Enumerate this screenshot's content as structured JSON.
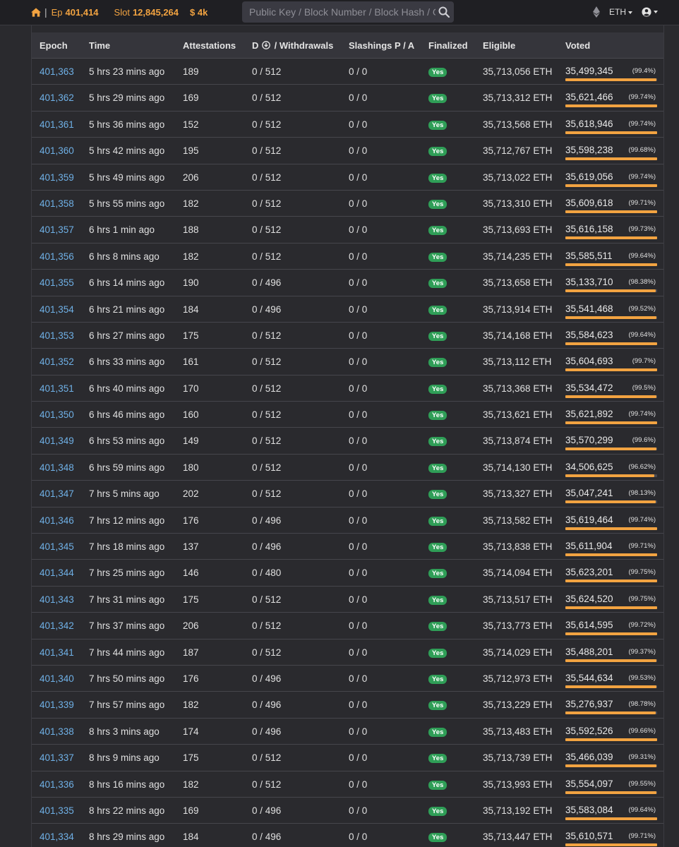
{
  "nav": {
    "epoch_label": "Ep",
    "epoch_value": "401,414",
    "slot_label": "Slot",
    "slot_value": "12,845,264",
    "price": "$ 4k",
    "search_placeholder": "Public Key / Block Number / Block Hash / Graffiti",
    "currency": "ETH",
    "icons": [
      "home-icon",
      "search-icon",
      "ethereum-logo-icon",
      "user-circle-icon",
      "chevron-down-icon"
    ]
  },
  "colors": {
    "accent": "#f2a341",
    "link": "#6fb0e6",
    "badge": "#2f9e57",
    "background": "#2a2a2e",
    "navbar": "#1f1f23"
  },
  "table": {
    "headers": {
      "epoch": "Epoch",
      "time": "Time",
      "attestations": "Attestations",
      "deposits_prefix": "D",
      "deposits_suffix": "/ Withdrawals",
      "slashings": "Slashings P / A",
      "finalized": "Finalized",
      "eligible": "Eligible",
      "voted": "Voted"
    },
    "rows": [
      {
        "epoch": "401,363",
        "time": "5 hrs 23 mins ago",
        "attestations": "189",
        "dw": "0 / 512",
        "slashings": "0 / 0",
        "finalized": "Yes",
        "eligible": "35,713,056 ETH",
        "voted": "35,499,345",
        "voted_pct": "(99.4%)",
        "fill": 99.4
      },
      {
        "epoch": "401,362",
        "time": "5 hrs 29 mins ago",
        "attestations": "169",
        "dw": "0 / 512",
        "slashings": "0 / 0",
        "finalized": "Yes",
        "eligible": "35,713,312 ETH",
        "voted": "35,621,466",
        "voted_pct": "(99.74%)",
        "fill": 99.74
      },
      {
        "epoch": "401,361",
        "time": "5 hrs 36 mins ago",
        "attestations": "152",
        "dw": "0 / 512",
        "slashings": "0 / 0",
        "finalized": "Yes",
        "eligible": "35,713,568 ETH",
        "voted": "35,618,946",
        "voted_pct": "(99.74%)",
        "fill": 99.74
      },
      {
        "epoch": "401,360",
        "time": "5 hrs 42 mins ago",
        "attestations": "195",
        "dw": "0 / 512",
        "slashings": "0 / 0",
        "finalized": "Yes",
        "eligible": "35,712,767 ETH",
        "voted": "35,598,238",
        "voted_pct": "(99.68%)",
        "fill": 99.68
      },
      {
        "epoch": "401,359",
        "time": "5 hrs 49 mins ago",
        "attestations": "206",
        "dw": "0 / 512",
        "slashings": "0 / 0",
        "finalized": "Yes",
        "eligible": "35,713,022 ETH",
        "voted": "35,619,056",
        "voted_pct": "(99.74%)",
        "fill": 99.74
      },
      {
        "epoch": "401,358",
        "time": "5 hrs 55 mins ago",
        "attestations": "182",
        "dw": "0 / 512",
        "slashings": "0 / 0",
        "finalized": "Yes",
        "eligible": "35,713,310 ETH",
        "voted": "35,609,618",
        "voted_pct": "(99.71%)",
        "fill": 99.71
      },
      {
        "epoch": "401,357",
        "time": "6 hrs 1 min ago",
        "attestations": "188",
        "dw": "0 / 512",
        "slashings": "0 / 0",
        "finalized": "Yes",
        "eligible": "35,713,693 ETH",
        "voted": "35,616,158",
        "voted_pct": "(99.73%)",
        "fill": 99.73
      },
      {
        "epoch": "401,356",
        "time": "6 hrs 8 mins ago",
        "attestations": "182",
        "dw": "0 / 512",
        "slashings": "0 / 0",
        "finalized": "Yes",
        "eligible": "35,714,235 ETH",
        "voted": "35,585,511",
        "voted_pct": "(99.64%)",
        "fill": 99.64
      },
      {
        "epoch": "401,355",
        "time": "6 hrs 14 mins ago",
        "attestations": "190",
        "dw": "0 / 496",
        "slashings": "0 / 0",
        "finalized": "Yes",
        "eligible": "35,713,658 ETH",
        "voted": "35,133,710",
        "voted_pct": "(98.38%)",
        "fill": 98.38
      },
      {
        "epoch": "401,354",
        "time": "6 hrs 21 mins ago",
        "attestations": "184",
        "dw": "0 / 496",
        "slashings": "0 / 0",
        "finalized": "Yes",
        "eligible": "35,713,914 ETH",
        "voted": "35,541,468",
        "voted_pct": "(99.52%)",
        "fill": 99.52
      },
      {
        "epoch": "401,353",
        "time": "6 hrs 27 mins ago",
        "attestations": "175",
        "dw": "0 / 512",
        "slashings": "0 / 0",
        "finalized": "Yes",
        "eligible": "35,714,168 ETH",
        "voted": "35,584,623",
        "voted_pct": "(99.64%)",
        "fill": 99.64
      },
      {
        "epoch": "401,352",
        "time": "6 hrs 33 mins ago",
        "attestations": "161",
        "dw": "0 / 512",
        "slashings": "0 / 0",
        "finalized": "Yes",
        "eligible": "35,713,112 ETH",
        "voted": "35,604,693",
        "voted_pct": "(99.7%)",
        "fill": 99.7
      },
      {
        "epoch": "401,351",
        "time": "6 hrs 40 mins ago",
        "attestations": "170",
        "dw": "0 / 512",
        "slashings": "0 / 0",
        "finalized": "Yes",
        "eligible": "35,713,368 ETH",
        "voted": "35,534,472",
        "voted_pct": "(99.5%)",
        "fill": 99.5
      },
      {
        "epoch": "401,350",
        "time": "6 hrs 46 mins ago",
        "attestations": "160",
        "dw": "0 / 512",
        "slashings": "0 / 0",
        "finalized": "Yes",
        "eligible": "35,713,621 ETH",
        "voted": "35,621,892",
        "voted_pct": "(99.74%)",
        "fill": 99.74
      },
      {
        "epoch": "401,349",
        "time": "6 hrs 53 mins ago",
        "attestations": "149",
        "dw": "0 / 512",
        "slashings": "0 / 0",
        "finalized": "Yes",
        "eligible": "35,713,874 ETH",
        "voted": "35,570,299",
        "voted_pct": "(99.6%)",
        "fill": 99.6
      },
      {
        "epoch": "401,348",
        "time": "6 hrs 59 mins ago",
        "attestations": "180",
        "dw": "0 / 512",
        "slashings": "0 / 0",
        "finalized": "Yes",
        "eligible": "35,714,130 ETH",
        "voted": "34,506,625",
        "voted_pct": "(96.62%)",
        "fill": 96.62
      },
      {
        "epoch": "401,347",
        "time": "7 hrs 5 mins ago",
        "attestations": "202",
        "dw": "0 / 512",
        "slashings": "0 / 0",
        "finalized": "Yes",
        "eligible": "35,713,327 ETH",
        "voted": "35,047,241",
        "voted_pct": "(98.13%)",
        "fill": 98.13
      },
      {
        "epoch": "401,346",
        "time": "7 hrs 12 mins ago",
        "attestations": "176",
        "dw": "0 / 496",
        "slashings": "0 / 0",
        "finalized": "Yes",
        "eligible": "35,713,582 ETH",
        "voted": "35,619,464",
        "voted_pct": "(99.74%)",
        "fill": 99.74
      },
      {
        "epoch": "401,345",
        "time": "7 hrs 18 mins ago",
        "attestations": "137",
        "dw": "0 / 496",
        "slashings": "0 / 0",
        "finalized": "Yes",
        "eligible": "35,713,838 ETH",
        "voted": "35,611,904",
        "voted_pct": "(99.71%)",
        "fill": 99.71
      },
      {
        "epoch": "401,344",
        "time": "7 hrs 25 mins ago",
        "attestations": "146",
        "dw": "0 / 480",
        "slashings": "0 / 0",
        "finalized": "Yes",
        "eligible": "35,714,094 ETH",
        "voted": "35,623,201",
        "voted_pct": "(99.75%)",
        "fill": 99.75
      },
      {
        "epoch": "401,343",
        "time": "7 hrs 31 mins ago",
        "attestations": "175",
        "dw": "0 / 512",
        "slashings": "0 / 0",
        "finalized": "Yes",
        "eligible": "35,713,517 ETH",
        "voted": "35,624,520",
        "voted_pct": "(99.75%)",
        "fill": 99.75
      },
      {
        "epoch": "401,342",
        "time": "7 hrs 37 mins ago",
        "attestations": "206",
        "dw": "0 / 512",
        "slashings": "0 / 0",
        "finalized": "Yes",
        "eligible": "35,713,773 ETH",
        "voted": "35,614,595",
        "voted_pct": "(99.72%)",
        "fill": 99.72
      },
      {
        "epoch": "401,341",
        "time": "7 hrs 44 mins ago",
        "attestations": "187",
        "dw": "0 / 512",
        "slashings": "0 / 0",
        "finalized": "Yes",
        "eligible": "35,714,029 ETH",
        "voted": "35,488,201",
        "voted_pct": "(99.37%)",
        "fill": 99.37
      },
      {
        "epoch": "401,340",
        "time": "7 hrs 50 mins ago",
        "attestations": "176",
        "dw": "0 / 496",
        "slashings": "0 / 0",
        "finalized": "Yes",
        "eligible": "35,712,973 ETH",
        "voted": "35,544,634",
        "voted_pct": "(99.53%)",
        "fill": 99.53
      },
      {
        "epoch": "401,339",
        "time": "7 hrs 57 mins ago",
        "attestations": "182",
        "dw": "0 / 496",
        "slashings": "0 / 0",
        "finalized": "Yes",
        "eligible": "35,713,229 ETH",
        "voted": "35,276,937",
        "voted_pct": "(98.78%)",
        "fill": 98.78
      },
      {
        "epoch": "401,338",
        "time": "8 hrs 3 mins ago",
        "attestations": "174",
        "dw": "0 / 496",
        "slashings": "0 / 0",
        "finalized": "Yes",
        "eligible": "35,713,483 ETH",
        "voted": "35,592,526",
        "voted_pct": "(99.66%)",
        "fill": 99.66
      },
      {
        "epoch": "401,337",
        "time": "8 hrs 9 mins ago",
        "attestations": "175",
        "dw": "0 / 512",
        "slashings": "0 / 0",
        "finalized": "Yes",
        "eligible": "35,713,739 ETH",
        "voted": "35,466,039",
        "voted_pct": "(99.31%)",
        "fill": 99.31
      },
      {
        "epoch": "401,336",
        "time": "8 hrs 16 mins ago",
        "attestations": "182",
        "dw": "0 / 512",
        "slashings": "0 / 0",
        "finalized": "Yes",
        "eligible": "35,713,993 ETH",
        "voted": "35,554,097",
        "voted_pct": "(99.55%)",
        "fill": 99.55
      },
      {
        "epoch": "401,335",
        "time": "8 hrs 22 mins ago",
        "attestations": "169",
        "dw": "0 / 496",
        "slashings": "0 / 0",
        "finalized": "Yes",
        "eligible": "35,713,192 ETH",
        "voted": "35,583,084",
        "voted_pct": "(99.64%)",
        "fill": 99.64
      },
      {
        "epoch": "401,334",
        "time": "8 hrs 29 mins ago",
        "attestations": "184",
        "dw": "0 / 496",
        "slashings": "0 / 0",
        "finalized": "Yes",
        "eligible": "35,713,447 ETH",
        "voted": "35,610,571",
        "voted_pct": "(99.71%)",
        "fill": 99.71
      }
    ]
  }
}
